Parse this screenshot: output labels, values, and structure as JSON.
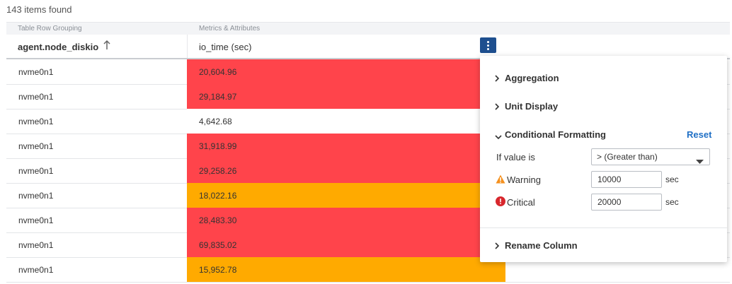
{
  "header": {
    "items_found": "143 items found"
  },
  "table": {
    "group_headers": [
      "Table Row Grouping",
      "Metrics & Attributes"
    ],
    "columns": [
      "agent.node_diskio",
      "io_time (sec)"
    ],
    "rows": [
      {
        "name": "nvme0n1",
        "value": "20,604.96",
        "status": "critical"
      },
      {
        "name": "nvme0n1",
        "value": "29,184.97",
        "status": "critical"
      },
      {
        "name": "nvme0n1",
        "value": "4,642.68",
        "status": "normal"
      },
      {
        "name": "nvme0n1",
        "value": "31,918.99",
        "status": "critical"
      },
      {
        "name": "nvme0n1",
        "value": "29,258.26",
        "status": "critical"
      },
      {
        "name": "nvme0n1",
        "value": "18,022.16",
        "status": "warning"
      },
      {
        "name": "nvme0n1",
        "value": "28,483.30",
        "status": "critical"
      },
      {
        "name": "nvme0n1",
        "value": "69,835.02",
        "status": "critical"
      },
      {
        "name": "nvme0n1",
        "value": "15,952.78",
        "status": "warning"
      }
    ]
  },
  "panel": {
    "aggregation": "Aggregation",
    "unit_display": "Unit Display",
    "conditional_formatting": "Conditional Formatting",
    "reset": "Reset",
    "if_value_is": "If value is",
    "operator": "> (Greater than)",
    "warning_label": "Warning",
    "warning_value": "10000",
    "critical_label": "Critical",
    "critical_value": "20000",
    "unit": "sec",
    "rename_column": "Rename Column"
  },
  "colors": {
    "critical": "#ff444b",
    "warning": "#ffaa00",
    "normal": "#ffffff",
    "accent": "#1e4f8f",
    "link": "#1f6fc5"
  },
  "icons": {
    "sort": "arrow-up-icon",
    "menu": "kebab-menu-icon",
    "expand": "chevron-right-icon",
    "collapse": "chevron-down-icon",
    "warning": "warning-triangle-icon",
    "critical": "error-circle-icon",
    "dropdown": "caret-down-icon"
  }
}
